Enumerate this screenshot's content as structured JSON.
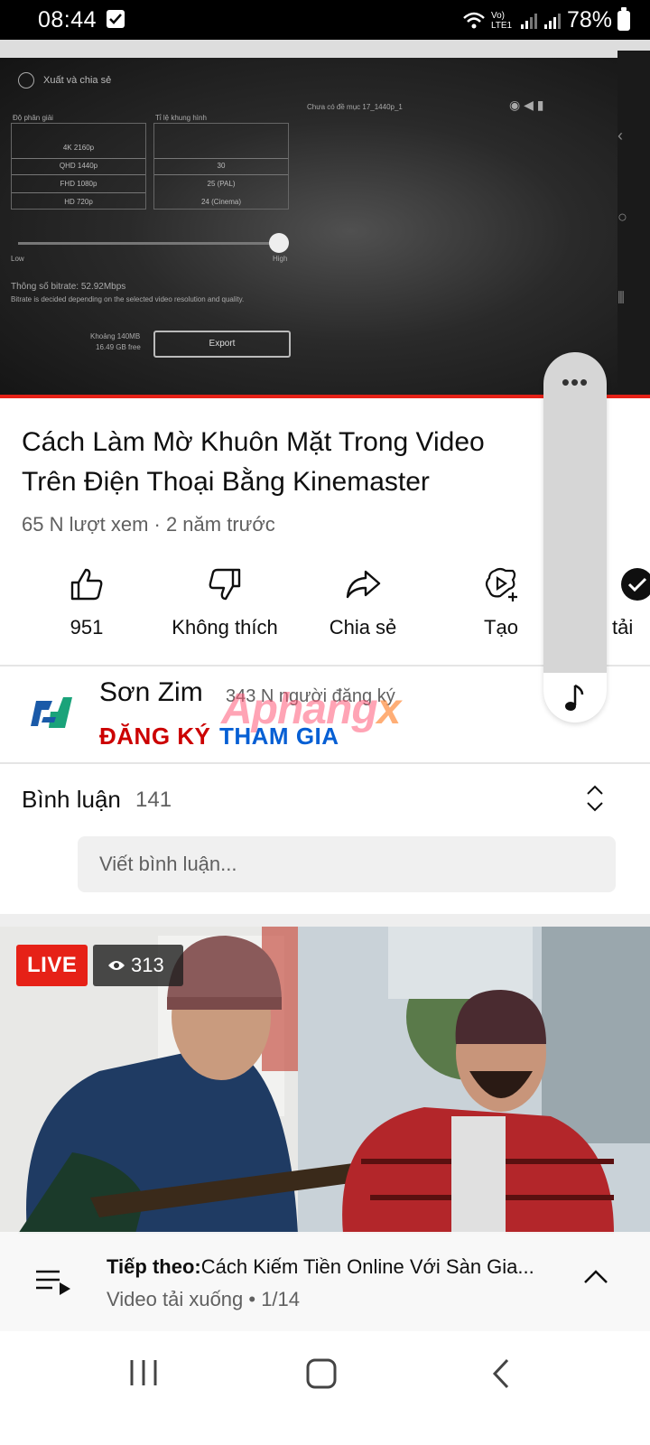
{
  "status_bar": {
    "time": "08:44",
    "network": "Vo) LTE1",
    "battery": "78%"
  },
  "player": {
    "embedded_app": {
      "header": "Xuất và chia sẻ",
      "resolution_label": "Độ phân giải",
      "framerate_label": "Tỉ lệ khung hình",
      "resolutions": [
        "4K 2160p",
        "QHD 1440p",
        "FHD 1080p",
        "HD 720p"
      ],
      "framerates": [
        "",
        "30",
        "25 (PAL)",
        "24 (Cinema)"
      ],
      "low": "Low",
      "high": "High",
      "bitrate": "Thông số bitrate: 52.92Mbps",
      "bitrate_note": "Bitrate is decided depending on the selected video resolution and quality.",
      "size": "Khoảng 140MB",
      "free": "16.49 GB free",
      "export": "Export",
      "folder": "Chưa có đề mục 17_1440p_1"
    }
  },
  "video": {
    "title": "Cách Làm Mờ Khuôn Mặt Trong Video Trên Điện Thoại Bằng Kinemaster",
    "meta": "65 N lượt xem · 2 năm trước"
  },
  "actions": {
    "like": "951",
    "dislike": "Không thích",
    "share": "Chia sẻ",
    "create": "Tạo",
    "download": "tải"
  },
  "channel": {
    "name": "Sơn Zim",
    "subscribers": "343 N người đăng ký",
    "subscribe": "ĐĂNG KÝ",
    "join": "THAM GIA"
  },
  "watermark": {
    "text": "Aphang",
    "x": "x"
  },
  "comments": {
    "label": "Bình luận",
    "count": "141",
    "placeholder": "Viết bình luận..."
  },
  "live": {
    "badge": "LIVE",
    "viewers": "313"
  },
  "up_next": {
    "prefix": "Tiếp theo:",
    "title": "Cách Kiếm Tiền Online Với Sàn Gia...",
    "subtitle": "Video tải xuống • 1/14"
  },
  "colors": {
    "accent_red": "#e62117",
    "subscribe_red": "#cc0000",
    "join_blue": "#065fd4"
  }
}
